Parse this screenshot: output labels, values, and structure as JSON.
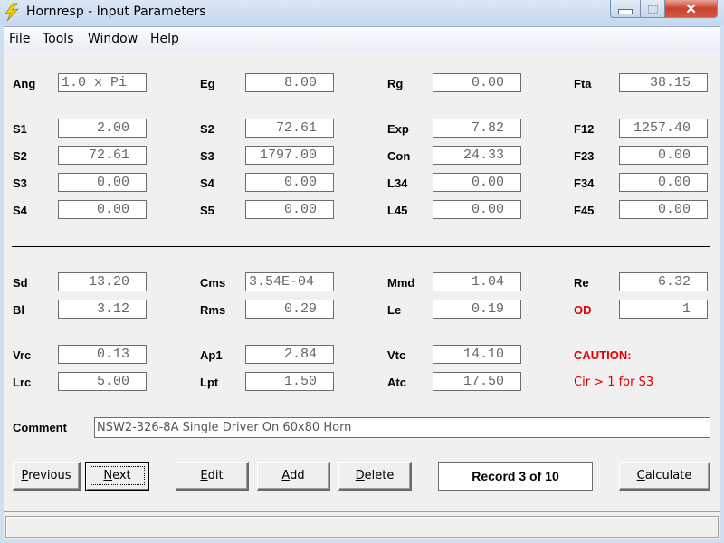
{
  "window": {
    "title": "Hornresp - Input Parameters",
    "icon": "lightning-bolt-icon",
    "controls": {
      "minimize": "minimize-icon",
      "maximize": "maximize-icon",
      "close": "close-icon"
    }
  },
  "menu": [
    "File",
    "Tools",
    "Window",
    "Help"
  ],
  "fields": {
    "ang": {
      "label": "Ang",
      "value": "1.0 x Pi"
    },
    "eg": {
      "label": "Eg",
      "value": "8.00"
    },
    "rg": {
      "label": "Rg",
      "value": "0.00"
    },
    "fta": {
      "label": "Fta",
      "value": "38.15"
    },
    "s1": {
      "label": "S1",
      "value": "2.00"
    },
    "s2a": {
      "label": "S2",
      "value": "72.61"
    },
    "exp": {
      "label": "Exp",
      "value": "7.82"
    },
    "f12": {
      "label": "F12",
      "value": "1257.40"
    },
    "s2b": {
      "label": "S2",
      "value": "72.61"
    },
    "s3a": {
      "label": "S3",
      "value": "1797.00"
    },
    "con": {
      "label": "Con",
      "value": "24.33"
    },
    "f23": {
      "label": "F23",
      "value": "0.00"
    },
    "s3b": {
      "label": "S3",
      "value": "0.00"
    },
    "s4a": {
      "label": "S4",
      "value": "0.00"
    },
    "l34": {
      "label": "L34",
      "value": "0.00"
    },
    "f34": {
      "label": "F34",
      "value": "0.00"
    },
    "s4b": {
      "label": "S4",
      "value": "0.00"
    },
    "s5": {
      "label": "S5",
      "value": "0.00"
    },
    "l45": {
      "label": "L45",
      "value": "0.00"
    },
    "f45": {
      "label": "F45",
      "value": "0.00"
    },
    "sd": {
      "label": "Sd",
      "value": "13.20"
    },
    "cms": {
      "label": "Cms",
      "value": "3.54E-04"
    },
    "mmd": {
      "label": "Mmd",
      "value": "1.04"
    },
    "re": {
      "label": "Re",
      "value": "6.32"
    },
    "bl": {
      "label": "Bl",
      "value": "3.12"
    },
    "rms": {
      "label": "Rms",
      "value": "0.29"
    },
    "le": {
      "label": "Le",
      "value": "0.19"
    },
    "od": {
      "label": "OD",
      "value": "1"
    },
    "vrc": {
      "label": "Vrc",
      "value": "0.13"
    },
    "ap1": {
      "label": "Ap1",
      "value": "2.84"
    },
    "vtc": {
      "label": "Vtc",
      "value": "14.10"
    },
    "lrc": {
      "label": "Lrc",
      "value": "5.00"
    },
    "lpt": {
      "label": "Lpt",
      "value": "1.50"
    },
    "atc": {
      "label": "Atc",
      "value": "17.50"
    }
  },
  "caution": {
    "title": "CAUTION:",
    "message": "Cir > 1 for S3",
    "color": "#e00000"
  },
  "comment": {
    "label": "Comment",
    "value": "NSW2-326-8A Single Driver On 60x80 Horn"
  },
  "buttons": {
    "previous": {
      "accel": "P",
      "rest": "revious"
    },
    "next": {
      "accel": "N",
      "rest": "ext"
    },
    "edit": {
      "accel": "E",
      "rest": "dit"
    },
    "add": {
      "accel": "A",
      "rest": "dd"
    },
    "delete": {
      "accel": "D",
      "rest": "elete"
    },
    "calculate": {
      "accel": "C",
      "rest": "alculate"
    }
  },
  "record": "Record 3 of 10",
  "status": ""
}
